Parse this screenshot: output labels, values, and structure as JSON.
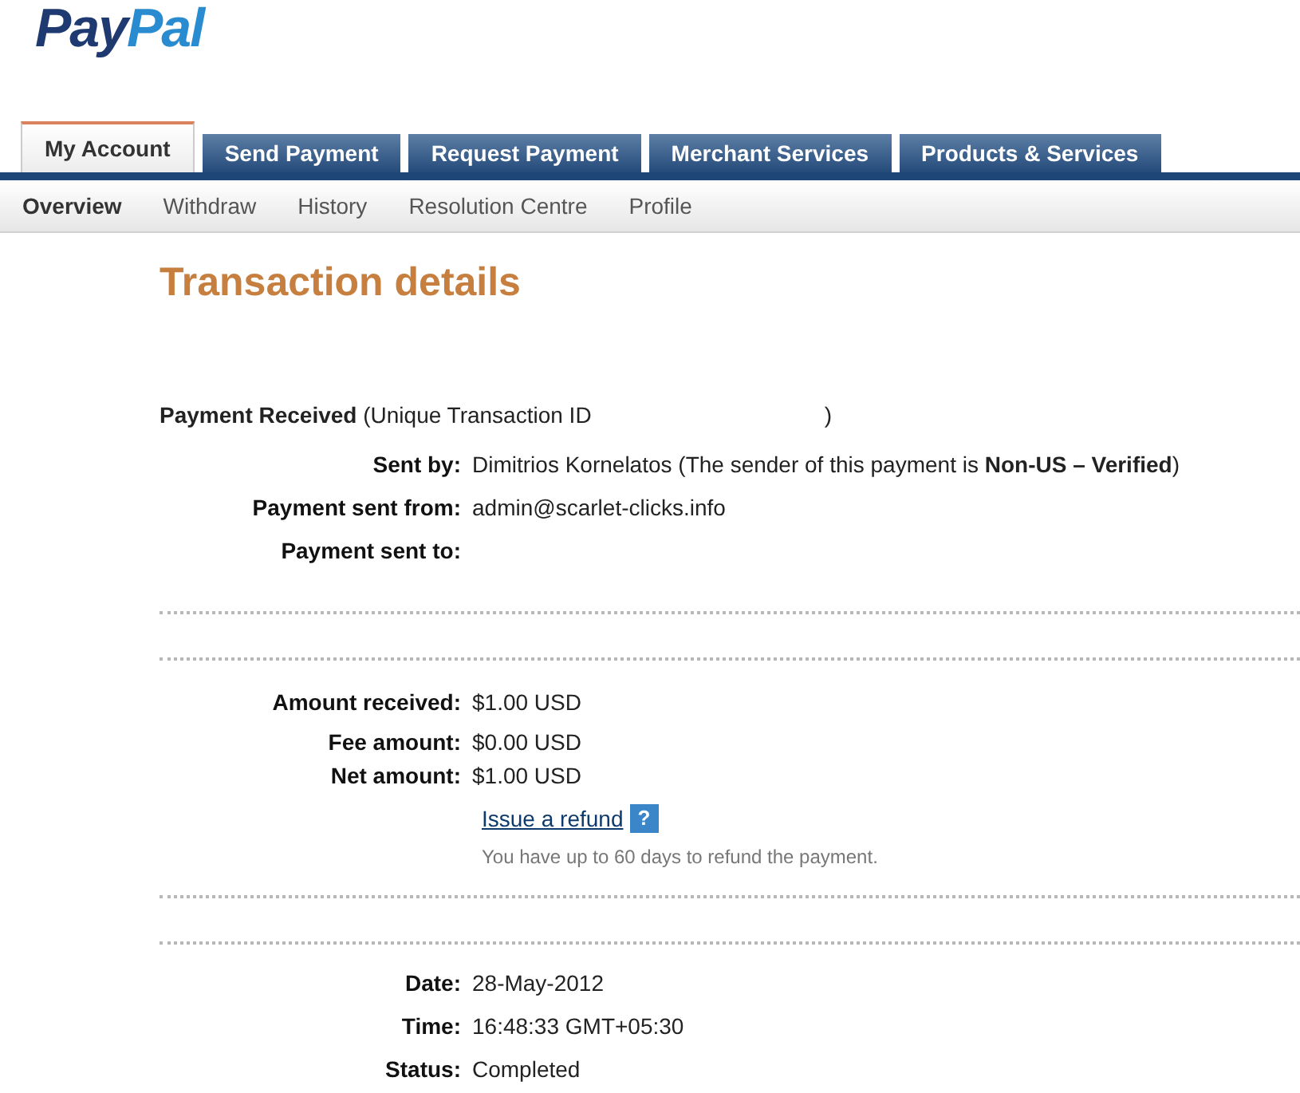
{
  "logo": [
    "Pay",
    "Pal"
  ],
  "tabs": [
    {
      "label": "My Account",
      "selected": true
    },
    {
      "label": "Send Payment",
      "selected": false
    },
    {
      "label": "Request Payment",
      "selected": false
    },
    {
      "label": "Merchant Services",
      "selected": false
    },
    {
      "label": "Products & Services",
      "selected": false
    }
  ],
  "subnav": [
    {
      "label": "Overview",
      "selected": true
    },
    {
      "label": "Withdraw",
      "selected": false
    },
    {
      "label": "History",
      "selected": false
    },
    {
      "label": "Resolution Centre",
      "selected": false
    },
    {
      "label": "Profile",
      "selected": false
    }
  ],
  "title": "Transaction details",
  "payment_heading": {
    "text": "**Payment Received** (Unique Transaction ID",
    "closing": ")"
  },
  "party_rows": [
    {
      "label": "Sent by:",
      "value": "Dimitrios Kornelatos (The sender of this payment is **Non-US – Verified**)"
    },
    {
      "label": "Payment sent from:",
      "value": "admin@scarlet-clicks.info"
    },
    {
      "label": "Payment sent to:"
    }
  ],
  "amount_rows": [
    {
      "label": "Amount received:",
      "value": "$1.00 USD"
    },
    {
      "label": "Fee amount:",
      "value": "$0.00 USD"
    },
    {
      "label": "Net amount:",
      "value": "$1.00 USD"
    }
  ],
  "refund": {
    "link": "Issue a refund",
    "help": "?",
    "note": "You have up to 60 days to refund the payment."
  },
  "date_rows": [
    {
      "label": "Date:",
      "value": "28-May-2012"
    },
    {
      "label": "Time:",
      "value": "16:48:33 GMT+05:30"
    },
    {
      "label": "Status:",
      "value": "Completed"
    }
  ]
}
